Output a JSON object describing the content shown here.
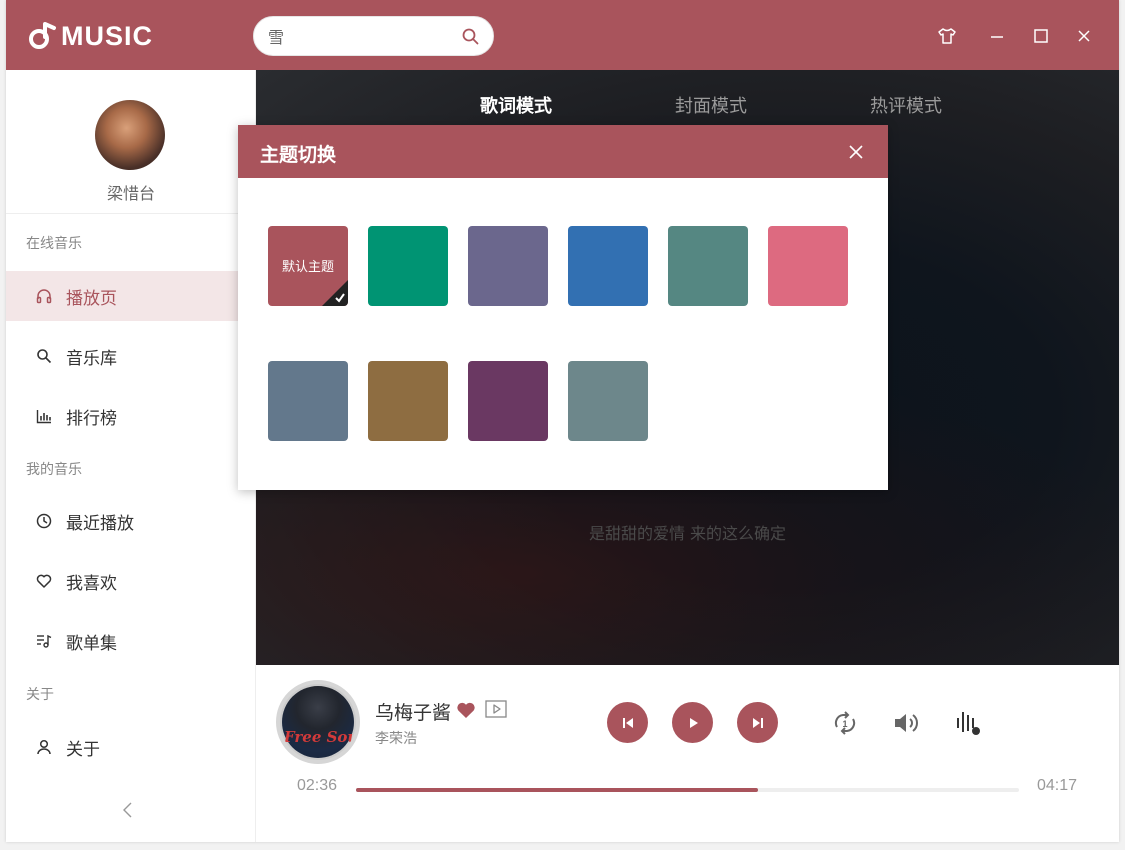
{
  "app": {
    "logo_text": "MUSIC",
    "brand_color": "#a9545c"
  },
  "search": {
    "value": "雪"
  },
  "window_controls": [
    "shirt-icon",
    "minimize-icon",
    "maximize-icon",
    "close-icon"
  ],
  "sidebar": {
    "user_name": "梁惜台",
    "groups": [
      {
        "label": "在线音乐"
      },
      {
        "label": "我的音乐"
      },
      {
        "label": "关于"
      }
    ],
    "items": [
      {
        "label": "播放页",
        "icon": "headphones-icon",
        "active": true
      },
      {
        "label": "音乐库",
        "icon": "search-icon",
        "active": false
      },
      {
        "label": "排行榜",
        "icon": "bar-chart-icon",
        "active": false
      },
      {
        "label": "最近播放",
        "icon": "clock-icon",
        "active": false
      },
      {
        "label": "我喜欢",
        "icon": "heart-icon",
        "active": false
      },
      {
        "label": "歌单集",
        "icon": "playlist-icon",
        "active": false
      },
      {
        "label": "关于",
        "icon": "user-icon",
        "active": false
      }
    ],
    "collapse_icon": "chevron-left-icon"
  },
  "main": {
    "tabs": [
      {
        "label": "歌词模式",
        "active": true
      },
      {
        "label": "封面模式",
        "active": false
      },
      {
        "label": "热评模式",
        "active": false
      }
    ],
    "lyric_line": "是甜甜的爱情 来的这么确定"
  },
  "player": {
    "cover_text": "Free Soul",
    "song_title": "乌梅子酱",
    "artist": "李荣浩",
    "liked": true,
    "current_time": "02:36",
    "total_time": "04:17",
    "progress": 0.607
  },
  "theme_dialog": {
    "title": "主题切换",
    "themes": [
      {
        "label": "默认主题",
        "color": "#a9545c",
        "selected": true
      },
      {
        "label": "",
        "color": "#009473",
        "selected": false
      },
      {
        "label": "",
        "color": "#6b678d",
        "selected": false
      },
      {
        "label": "",
        "color": "#3270b2",
        "selected": false
      },
      {
        "label": "",
        "color": "#558782",
        "selected": false
      },
      {
        "label": "",
        "color": "#dd6a80",
        "selected": false
      },
      {
        "label": "",
        "color": "#63788c",
        "selected": false
      },
      {
        "label": "",
        "color": "#8e6d41",
        "selected": false
      },
      {
        "label": "",
        "color": "#6a3862",
        "selected": false
      },
      {
        "label": "",
        "color": "#6d878b",
        "selected": false
      }
    ]
  }
}
